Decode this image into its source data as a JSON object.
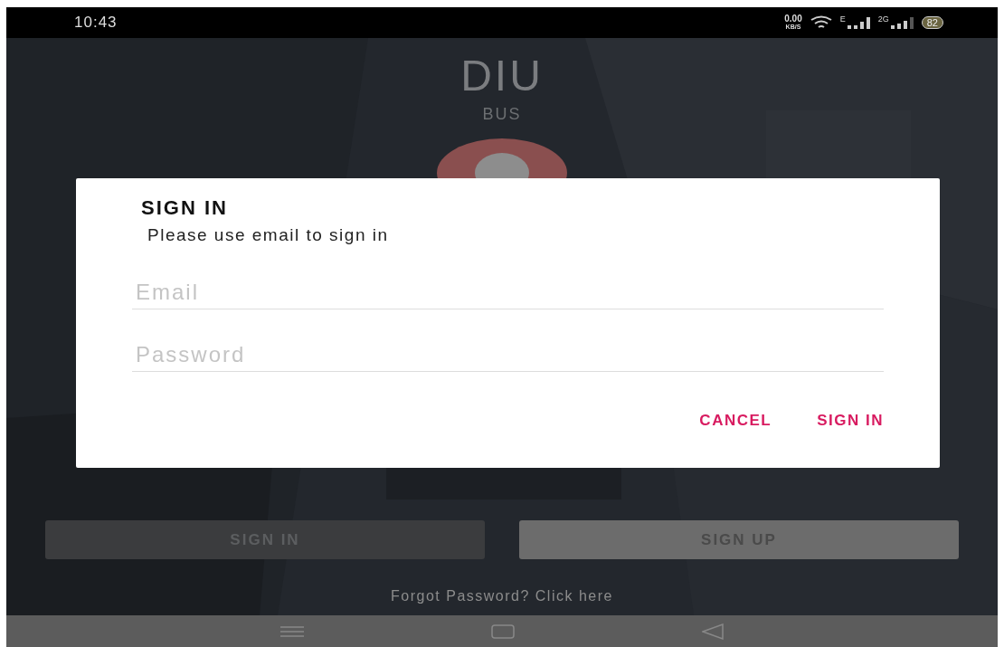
{
  "status_bar": {
    "time": "10:43",
    "speed": "0.00",
    "speed_unit": "KB/S",
    "network_1": "E",
    "network_2": "2G",
    "battery": "82"
  },
  "app": {
    "title": "DIU",
    "subtitle": "BUS"
  },
  "buttons": [
    {
      "label": "SIGN IN",
      "kind": "dark"
    },
    {
      "label": "SIGN UP",
      "kind": "light"
    }
  ],
  "forgot_link": "Forgot Password? Click here",
  "dialog": {
    "title": "SIGN IN",
    "message": "Please use email to sign in",
    "fields": [
      {
        "placeholder": "Email"
      },
      {
        "placeholder": "Password"
      }
    ],
    "actions": [
      "CANCEL",
      "SIGN IN"
    ]
  }
}
